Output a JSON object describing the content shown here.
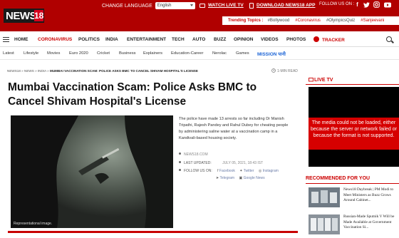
{
  "header": {
    "logo_text": "NEWS",
    "logo_number": "18",
    "change_language_label": "CHANGE LANGUAGE",
    "language_value": "English",
    "watch_live_label": "WATCH LIVE TV",
    "download_app_label": "DOWNLOAD NEWS18 APP",
    "follow_us_label": "FOLLOW US ON :",
    "social_icons": [
      "facebook-icon",
      "twitter-icon",
      "instagram-icon",
      "youtube-icon"
    ],
    "trending_label": "Trending Topics :",
    "trending_topics": [
      {
        "label": "#Bollywood",
        "highlight": false
      },
      {
        "label": "#Coronavirus",
        "highlight": true
      },
      {
        "label": "#OlympicsQuiz",
        "highlight": false
      },
      {
        "label": "#Sanjeevani",
        "highlight": true
      }
    ]
  },
  "nav": {
    "items": [
      "HOME",
      "CORONAVIRUS",
      "POLITICS",
      "INDIA",
      "ENTERTAINMENT",
      "TECH",
      "AUTO",
      "BUZZ",
      "OPINION",
      "VIDEOS",
      "PHOTOS"
    ],
    "tracker_label": "TRACKER"
  },
  "subnav": {
    "items": [
      "Latest",
      "Lifestyle",
      "Movies",
      "Euro 2020",
      "Cricket",
      "Business",
      "Explainers",
      "Education-Career",
      "Nerolac",
      "Games"
    ],
    "mission_label": "MISSION पानी"
  },
  "breadcrumb": {
    "items": [
      "NEWS18",
      "NEWS",
      "INDIA"
    ],
    "current": "MUMBAI VACCINATION SCAM: POLICE ASKS BMC TO CANCEL SHIVAM HOSPITAL'S LICENSE",
    "read_time": "1-MIN READ"
  },
  "article": {
    "title": "Mumbai Vaccination Scam: Police Asks BMC to Cancel Shivam Hospital's License",
    "image_caption": "Representational image.",
    "summary": "The police have made 13 arrests so far including Dr Manish Tripathi, Rajesh Pandey and Rahul Dubey for cheating people by administering saline water at a vaccination camp in a Kandivali-based housing society.",
    "source": "NEWS18.COM",
    "last_updated_label": "LAST UPDATED:",
    "last_updated_value": "JULY 05, 2021, 18:43 IST",
    "follow_us_label": "FOLLOW US ON:",
    "share_links": [
      "Facebook",
      "Twitter",
      "Instagram",
      "Telegram",
      "Google News"
    ]
  },
  "sidebar": {
    "live_tv_label": "LIVE TV",
    "video_error": "The media could not be loaded, either because the server or network failed or because the format is not supported.",
    "recommended_label": "RECOMMENDED FOR YOU",
    "recommended": [
      {
        "title": "News18 Daybreak | PM Modi to Meet Ministers as Buzz Grows Around Cabinet..."
      },
      {
        "title": "Russian-Made Sputnik V Will be Made Available at Government Vaccination Si..."
      }
    ]
  },
  "colors": {
    "brand_red": "#b00000",
    "accent_red": "#c80000",
    "link_blue": "#1c64d6"
  }
}
